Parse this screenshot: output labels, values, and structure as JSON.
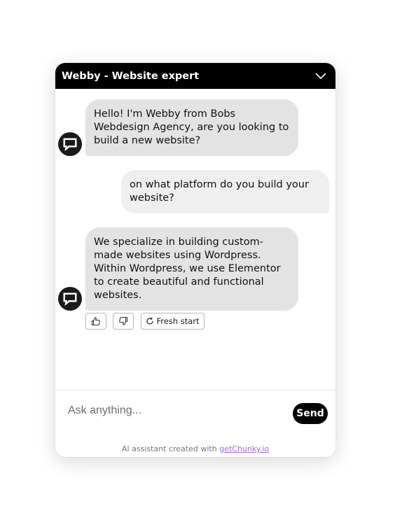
{
  "header": {
    "title": "Webby - Website expert",
    "toggle_icon": "chevron-down-icon"
  },
  "messages": [
    {
      "role": "bot",
      "text": "Hello! I'm Webby from Bobs\nWebdesign Agency, are you looking to\nbuild a new website?"
    },
    {
      "role": "user",
      "text": "on what platform do you build your\nwebsite?"
    },
    {
      "role": "bot",
      "text": "We specialize in building custom-\nmade websites using Wordpress.\nWithin Wordpress, we use Elementor\nto create beautiful and functional\nwebsites."
    }
  ],
  "feedback": {
    "like_icon": "thumbs-up-icon",
    "dislike_icon": "thumbs-down-icon",
    "restart_icon": "refresh-icon",
    "restart_label": "Fresh start"
  },
  "composer": {
    "placeholder": "Ask anything...",
    "send_label": "Send"
  },
  "footer": {
    "prefix": "AI assistant created with ",
    "link_label": "getChunky.io"
  },
  "colors": {
    "header_bg": "#000000",
    "bot_bubble": "#e3e3e3",
    "user_bubble": "#efefef",
    "link": "#9b6cd6"
  }
}
